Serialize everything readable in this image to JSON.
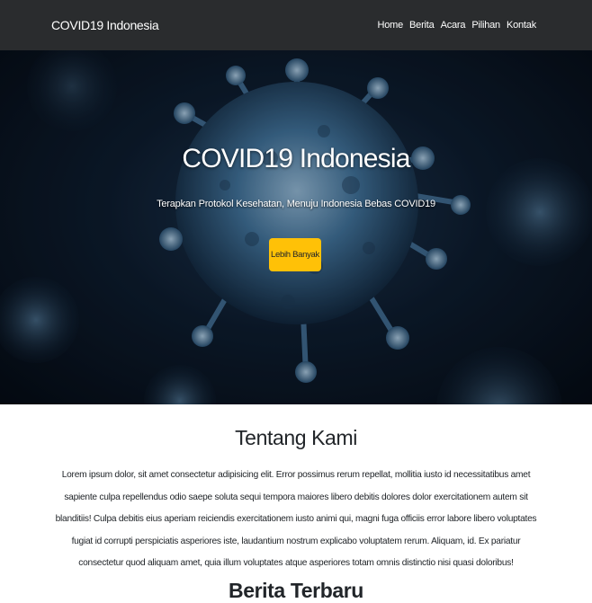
{
  "navbar": {
    "brand": "COVID19 Indonesia",
    "links": [
      "Home",
      "Berita",
      "Acara",
      "Pilihan",
      "Kontak"
    ]
  },
  "hero": {
    "title": "COVID19 Indonesia",
    "subtitle": "Terapkan Protokol Kesehatan, Menuju Indonesia Bebas COVID19",
    "button_label": "Lebih Banyak"
  },
  "about": {
    "title": "Tentang Kami",
    "text": "Lorem ipsum dolor, sit amet consectetur adipisicing elit. Error possimus rerum repellat, mollitia iusto id necessitatibus amet sapiente culpa repellendus odio saepe soluta sequi tempora maiores libero debitis dolores dolor exercitationem autem sit blanditiis! Culpa debitis eius aperiam reiciendis exercitationem iusto animi qui, magni fuga officiis error labore libero voluptates fugiat id corrupti perspiciatis asperiores iste, laudantium nostrum explicabo voluptatem rerum. Aliquam, id. Ex pariatur consectetur quod aliquam amet, quia illum voluptates atque asperiores totam omnis distinctio nisi quasi doloribus!"
  },
  "next_section": {
    "title": "Berita Terbaru"
  },
  "colors": {
    "navbar_bg": "#2a2c2e",
    "accent_button": "#ffc107",
    "hero_bg": "#0d1c2e"
  }
}
